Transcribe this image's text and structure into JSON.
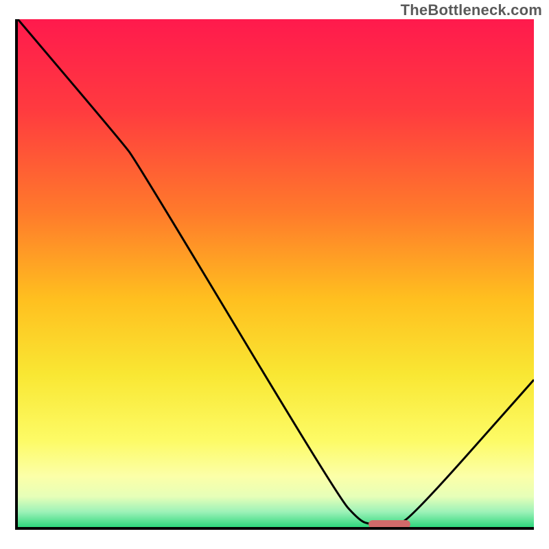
{
  "attribution": "TheBottleneck.com",
  "colors": {
    "curve_stroke": "#000000",
    "marker_fill": "#d06a6a",
    "border": "#000000"
  },
  "gradient_stops": [
    {
      "pct": 0,
      "color": "#ff1a4d"
    },
    {
      "pct": 18,
      "color": "#ff3b3f"
    },
    {
      "pct": 38,
      "color": "#ff7a2b"
    },
    {
      "pct": 55,
      "color": "#ffbf1f"
    },
    {
      "pct": 70,
      "color": "#f9e733"
    },
    {
      "pct": 83,
      "color": "#fdfb66"
    },
    {
      "pct": 90,
      "color": "#fcffa8"
    },
    {
      "pct": 94,
      "color": "#e6ffb8"
    },
    {
      "pct": 97,
      "color": "#9df2b8"
    },
    {
      "pct": 100,
      "color": "#2fd77d"
    }
  ],
  "chart_data": {
    "type": "line",
    "title": "",
    "xlabel": "",
    "ylabel": "",
    "xlim": [
      0,
      100
    ],
    "ylim": [
      0,
      100
    ],
    "grid": false,
    "legend": false,
    "curve_points": [
      {
        "x": 0,
        "y": 100
      },
      {
        "x": 20,
        "y": 76
      },
      {
        "x": 23,
        "y": 72
      },
      {
        "x": 62,
        "y": 6
      },
      {
        "x": 66,
        "y": 1.5
      },
      {
        "x": 68,
        "y": 0.5
      },
      {
        "x": 73,
        "y": 0.5
      },
      {
        "x": 76,
        "y": 1.5
      },
      {
        "x": 100,
        "y": 29
      }
    ],
    "marker": {
      "x_start": 68,
      "x_end": 76,
      "y": 0.5
    }
  }
}
